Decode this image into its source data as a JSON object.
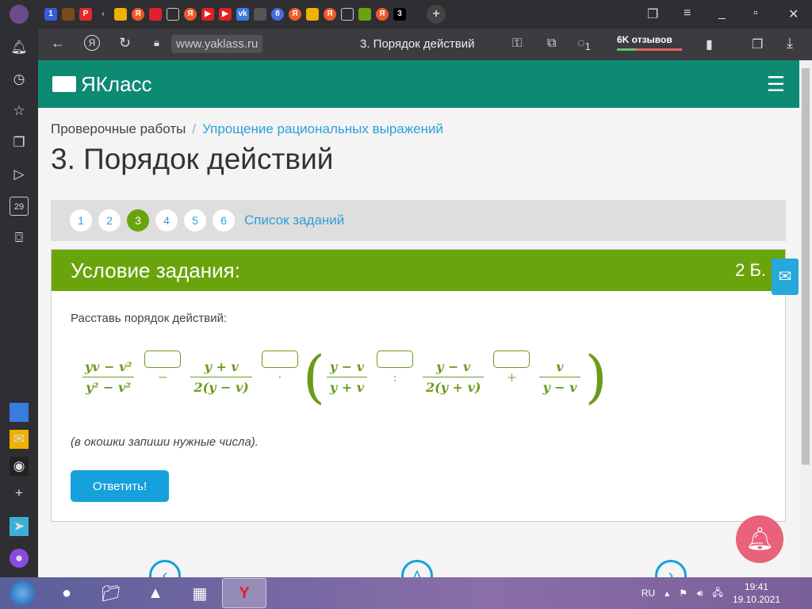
{
  "browser": {
    "tab_badges": [
      "1",
      "8",
      "3"
    ],
    "url": "www.yaklass.ru",
    "page_title": "3. Порядок действий",
    "reviews": "6K отзывов",
    "ext_badge": "1",
    "sidebar_badge": "29"
  },
  "site": {
    "logo": "ЯКласс",
    "breadcrumb": {
      "parent": "Проверочные работы",
      "separator": "/",
      "current": "Упрощение рациональных выражений"
    },
    "title": "3. Порядок действий",
    "steps": [
      "1",
      "2",
      "3",
      "4",
      "5",
      "6"
    ],
    "active_step": "3",
    "task_list": "Список заданий",
    "card": {
      "heading": "Условие задания:",
      "points": "2 Б.",
      "instruction": "Расставь порядок действий:",
      "expr": {
        "f1": {
          "n": "yv − v²",
          "d": "y² − v²"
        },
        "op1": "−",
        "f2": {
          "n": "y + v",
          "d": "2(y − v)"
        },
        "op2": "·",
        "open": "(",
        "f3": {
          "n": "y − v",
          "d": "y + v"
        },
        "op3": ":",
        "f4": {
          "n": "y − v",
          "d": "2(y + v)"
        },
        "op4": "+",
        "f5": {
          "n": "v",
          "d": "y − v"
        },
        "close": ")"
      },
      "hint": "(в окошки запиши нужные числа).",
      "answer_button": "Ответить!"
    }
  },
  "taskbar": {
    "lang": "RU",
    "time": "19:41",
    "date": "19.10.2021"
  }
}
